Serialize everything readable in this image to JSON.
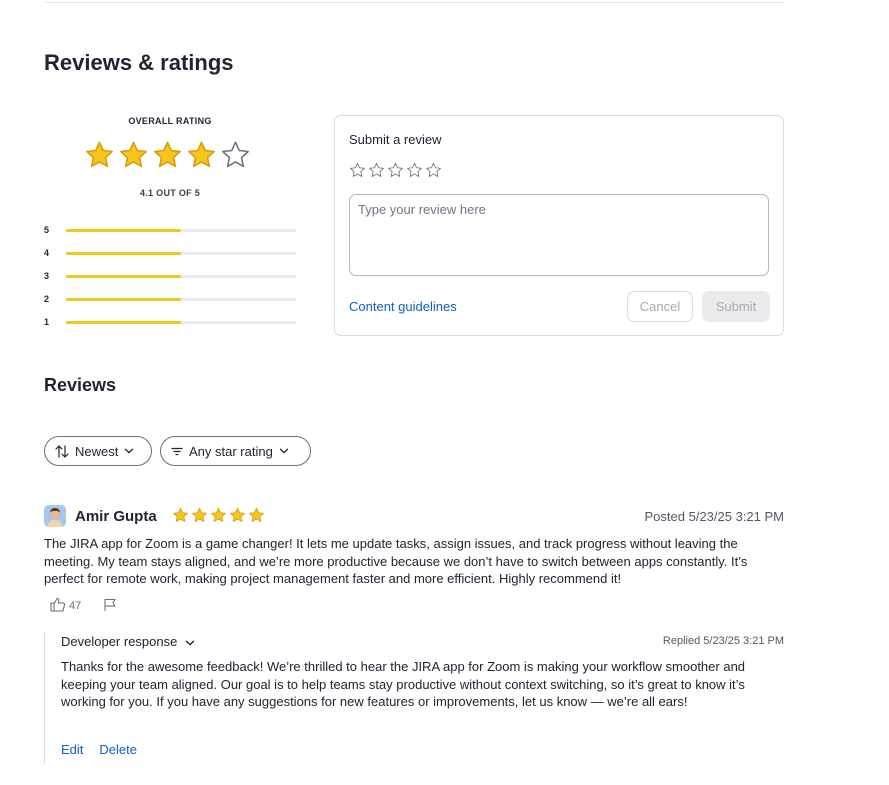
{
  "section_title": "Reviews & ratings",
  "overall": {
    "label": "OVERALL RATING",
    "stars_filled": 4,
    "stars_total": 5,
    "summary": "4.1 OUT OF 5",
    "distribution": [
      {
        "label": "5",
        "fraction": 0.5
      },
      {
        "label": "4",
        "fraction": 0.5
      },
      {
        "label": "3",
        "fraction": 0.5
      },
      {
        "label": "2",
        "fraction": 0.5
      },
      {
        "label": "1",
        "fraction": 0.5
      }
    ]
  },
  "submit": {
    "title": "Submit a review",
    "placeholder": "Type your review here",
    "guidelines_label": "Content guidelines",
    "cancel_label": "Cancel",
    "submit_label": "Submit"
  },
  "reviews_title": "Reviews",
  "filters": {
    "sort_label": "Newest",
    "star_filter_label": "Any star rating"
  },
  "review": {
    "name": "Amir Gupta",
    "stars": 5,
    "posted": "Posted 5/23/25 3:21 PM",
    "body": "The JIRA app for Zoom is a game changer! It lets me update tasks, assign issues, and track progress without leaving the meeting. My team stays aligned, and we’re more productive because we don’t have to switch between apps constantly. It’s perfect for remote work, making project management faster and more efficient. Highly recommend it!",
    "helpful_count": "47",
    "developer_response": {
      "toggle_label": "Developer response",
      "replied": "Replied 5/23/25 3:21 PM",
      "body": "Thanks for the awesome feedback! We’re thrilled to hear the JIRA app for Zoom is making your workflow smoother and keeping your team aligned. Our goal is to help teams stay productive without context switching, so it’s great to know it’s working for you. If you have any suggestions for new features or improvements, let us know — we’re all ears!",
      "edit_label": "Edit",
      "delete_label": "Delete"
    }
  },
  "colors": {
    "star_fill": "#f7c61c",
    "star_stroke": "#d99b0a",
    "bar_fill": "#f4c81b",
    "link": "#0e5fcc"
  },
  "icons": {
    "sort": "sort-arrows-icon",
    "filter": "filter-lines-icon",
    "chevron": "chevron-down-icon",
    "thumbs_up": "thumbs-up-icon",
    "flag": "flag-icon",
    "star": "star-icon"
  }
}
